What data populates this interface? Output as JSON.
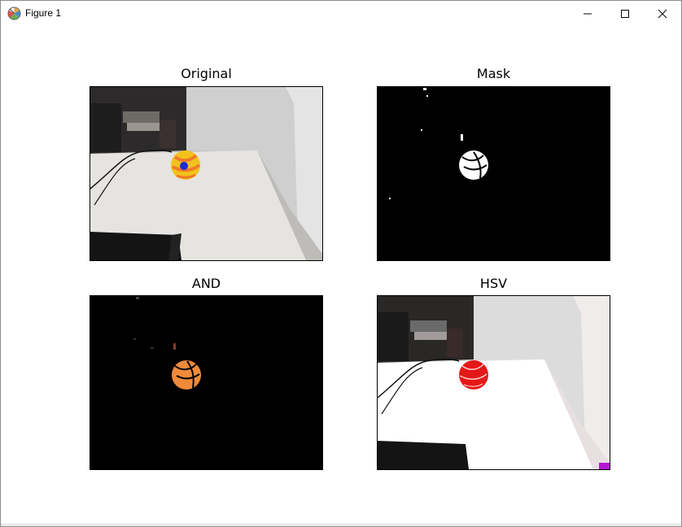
{
  "window": {
    "title": "Figure 1",
    "controls": [
      "minimize-icon",
      "maximize-icon",
      "close-icon"
    ]
  },
  "figure": {
    "subplots": [
      {
        "title": "Original"
      },
      {
        "title": "Mask"
      },
      {
        "title": "AND"
      },
      {
        "title": "HSV"
      }
    ]
  },
  "colors": {
    "ball_original": "#f2c21c",
    "ball_stripe": "#f07a2a",
    "marker": "#1f2bd8",
    "ball_and": "#f08a3a",
    "ball_hsv": "#e51717",
    "table_white": "#e9e8e6",
    "wall_gray": "#c9c9c9"
  }
}
